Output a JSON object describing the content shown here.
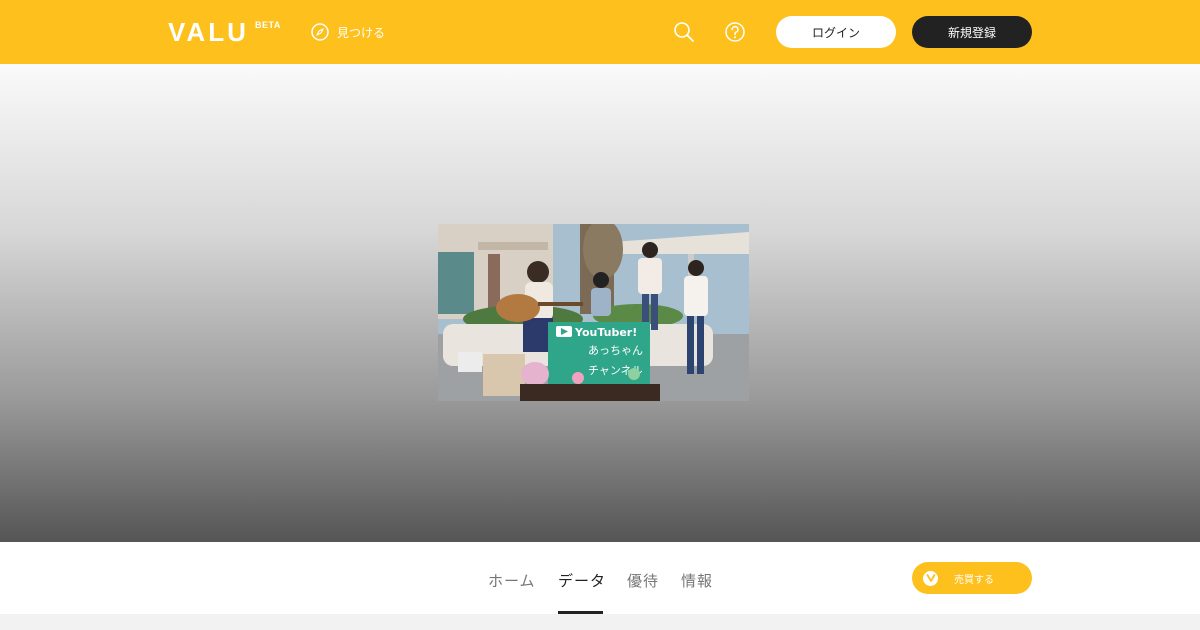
{
  "header": {
    "logo": "VALU",
    "beta": "BETA",
    "discover_label": "見つける",
    "login_label": "ログイン",
    "signup_label": "新規登録",
    "brand_color": "#fdc01c"
  },
  "hero": {
    "banner_text": "YouTuber!",
    "banner_text_2": "あっちゃん",
    "banner_text_3": "チャンネル"
  },
  "tabs": {
    "items": [
      {
        "label": "ホーム"
      },
      {
        "label": "データ"
      },
      {
        "label": "優待"
      },
      {
        "label": "情報"
      }
    ],
    "active": "データ",
    "trade_label": "売買する"
  }
}
